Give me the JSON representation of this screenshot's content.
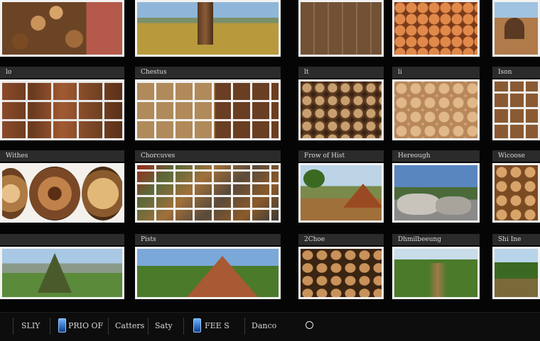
{
  "gallery": {
    "row2": [
      "lo",
      "Chestus",
      "lt",
      "li",
      "Ison"
    ],
    "row3": [
      "Withes",
      "Chorcuves",
      "Frow of Hist",
      "Hereough",
      "Wicoose"
    ],
    "row4": [
      "",
      "Pists",
      "2Choe",
      "Dhmilbeeung",
      "Shi Ine"
    ]
  },
  "taskbar": {
    "items": [
      "SLIY",
      "PRIO OF",
      "Catters",
      "Saty",
      "FEE S",
      "Danco"
    ]
  }
}
